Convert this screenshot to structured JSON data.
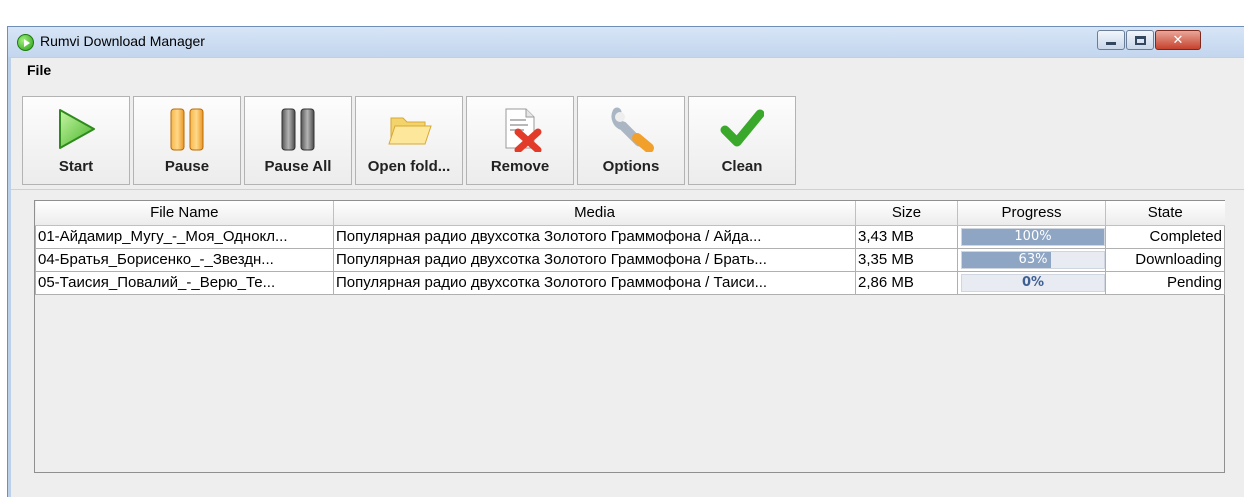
{
  "window": {
    "title": "Rumvi Download Manager"
  },
  "menu": {
    "file": "File"
  },
  "toolbar": {
    "start": "Start",
    "pause": "Pause",
    "pause_all": "Pause All",
    "open_folder": "Open fold...",
    "remove": "Remove",
    "options": "Options",
    "clean": "Clean"
  },
  "table": {
    "columns": [
      "File Name",
      "Media",
      "Size",
      "Progress",
      "State"
    ],
    "rows": [
      {
        "file_name": "01-Айдамир_Мугу_-_Моя_Однокл...",
        "media": "Популярная радио двухсотка Золотого Граммофона / Айда...",
        "size": "3,43  MB",
        "progress": 1.0,
        "progress_label": "100%",
        "state": "Completed"
      },
      {
        "file_name": "04-Братья_Борисенко_-_Звездн...",
        "media": "Популярная радио двухсотка Золотого Граммофона / Брать...",
        "size": "3,35  MB",
        "progress": 0.63,
        "progress_label": "63%",
        "state": "Downloading"
      },
      {
        "file_name": "05-Таисия_Повалий_-_Верю_Те...",
        "media": "Популярная радио двухсотка Золотого Граммофона / Таиси...",
        "size": "2,86  MB",
        "progress": 0.0,
        "progress_label": "0%",
        "state": "Pending"
      }
    ]
  },
  "colors": {
    "progress_fill": "#8ea5c3",
    "accent_green": "#3aa82a",
    "pause_orange": "#f0a030"
  }
}
